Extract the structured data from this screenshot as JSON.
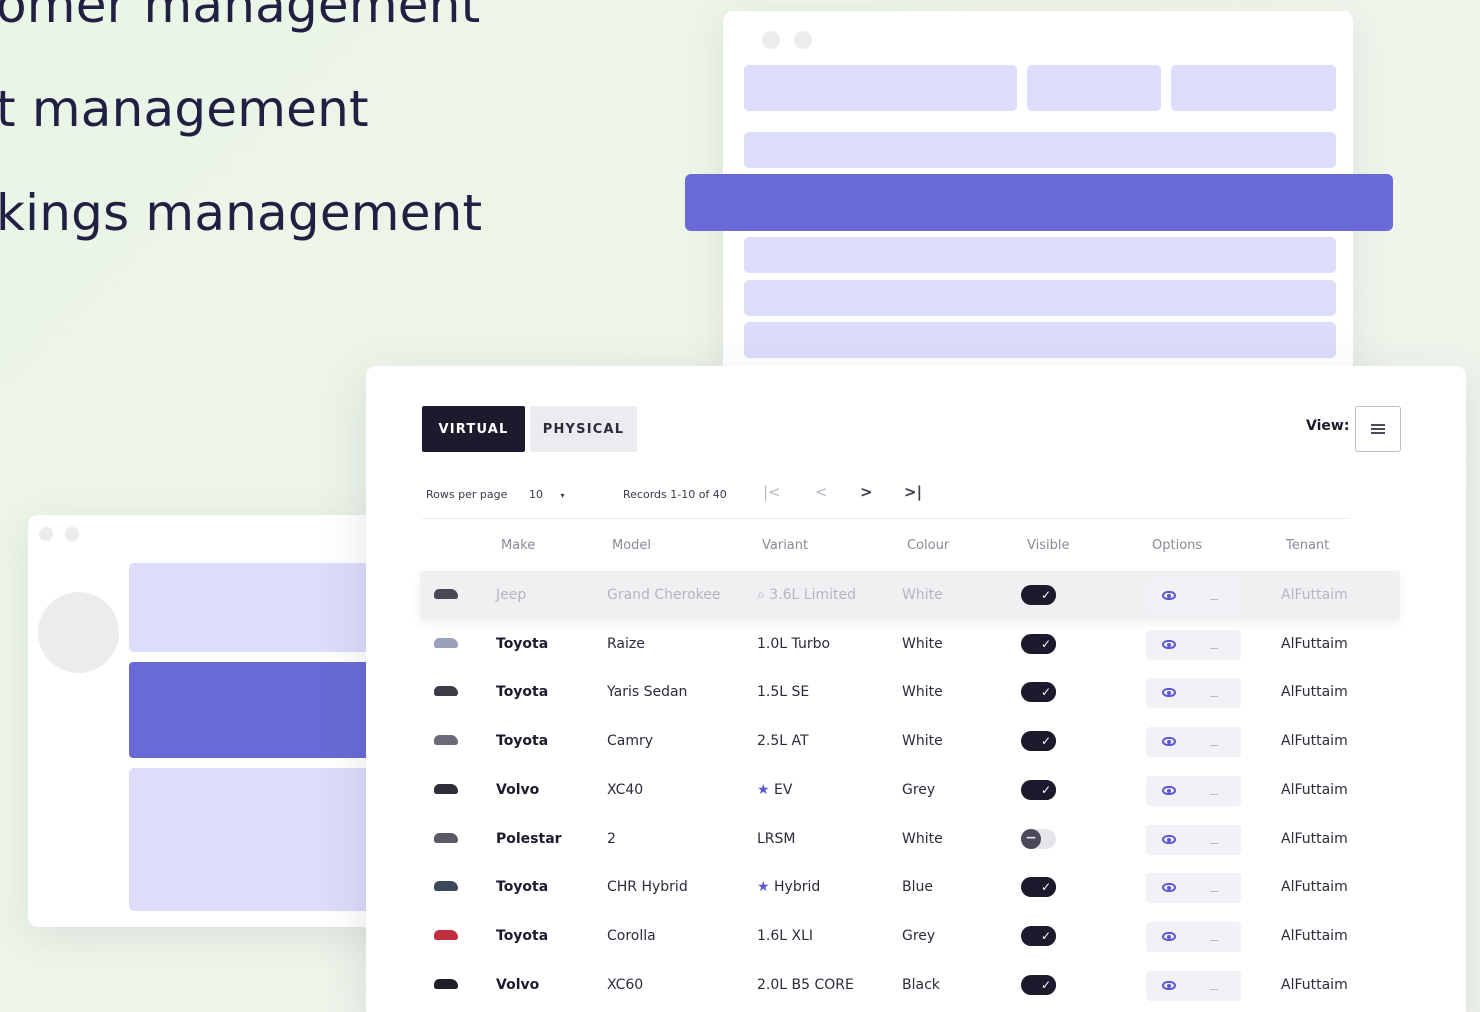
{
  "hero": {
    "lines": [
      "omer management",
      "t management",
      "kings management"
    ]
  },
  "tabs": {
    "virtual": "VIRTUAL",
    "physical": "PHYSICAL"
  },
  "view": {
    "label": "View:",
    "button_icon": "list-icon"
  },
  "pagination": {
    "rows_per_page_label": "Rows per page",
    "rows_per_page_value": "10",
    "records_label": "Records 1-10 of 40",
    "first_icon": "|<",
    "prev_icon": "<",
    "next_icon": ">",
    "last_icon": ">|"
  },
  "table": {
    "columns": [
      "Make",
      "Model",
      "Variant",
      "Colour",
      "Visible",
      "Options",
      "Tenant"
    ],
    "rows": [
      {
        "make": "Jeep",
        "model": "Grand Cherokee",
        "variant": "3.6L Limited",
        "variant_icon": "tag-icon",
        "colour": "White",
        "visible": true,
        "tenant": "AlFuttaim",
        "faded": true,
        "thumb_color": "#2b2b3a"
      },
      {
        "make": "Toyota",
        "model": "Raize",
        "variant": "1.0L Turbo",
        "variant_icon": "",
        "colour": "White",
        "visible": true,
        "tenant": "AlFuttaim",
        "faded": false,
        "thumb_color": "#9aa0b8"
      },
      {
        "make": "Toyota",
        "model": "Yaris Sedan",
        "variant": "1.5L SE",
        "variant_icon": "",
        "colour": "White",
        "visible": true,
        "tenant": "AlFuttaim",
        "faded": false,
        "thumb_color": "#3c3c48"
      },
      {
        "make": "Toyota",
        "model": "Camry",
        "variant": "2.5L AT",
        "variant_icon": "",
        "colour": "White",
        "visible": true,
        "tenant": "AlFuttaim",
        "faded": false,
        "thumb_color": "#6a6a78"
      },
      {
        "make": "Volvo",
        "model": "XC40",
        "variant": "EV",
        "variant_icon": "star-icon",
        "colour": "Grey",
        "visible": true,
        "tenant": "AlFuttaim",
        "faded": false,
        "thumb_color": "#2e2e38"
      },
      {
        "make": "Polestar",
        "model": "2",
        "variant": "LRSM",
        "variant_icon": "",
        "colour": "White",
        "visible": false,
        "tenant": "AlFuttaim",
        "faded": false,
        "thumb_color": "#5a5a66"
      },
      {
        "make": "Toyota",
        "model": "CHR Hybrid",
        "variant": "Hybrid",
        "variant_icon": "star-icon",
        "colour": "Blue",
        "visible": true,
        "tenant": "AlFuttaim",
        "faded": false,
        "thumb_color": "#3a4a5a"
      },
      {
        "make": "Toyota",
        "model": "Corolla",
        "variant": "1.6L XLI",
        "variant_icon": "",
        "colour": "Grey",
        "visible": true,
        "tenant": "AlFuttaim",
        "faded": false,
        "thumb_color": "#c23040"
      },
      {
        "make": "Volvo",
        "model": "XC60",
        "variant": "2.0L B5 CORE",
        "variant_icon": "",
        "colour": "Black",
        "visible": true,
        "tenant": "AlFuttaim",
        "faded": false,
        "thumb_color": "#1e1e26"
      }
    ]
  },
  "colors": {
    "accent": "#6a6ad6",
    "accent_light": "#dcdcfb",
    "dark": "#1c1b2e",
    "background": "#eef5ea"
  }
}
